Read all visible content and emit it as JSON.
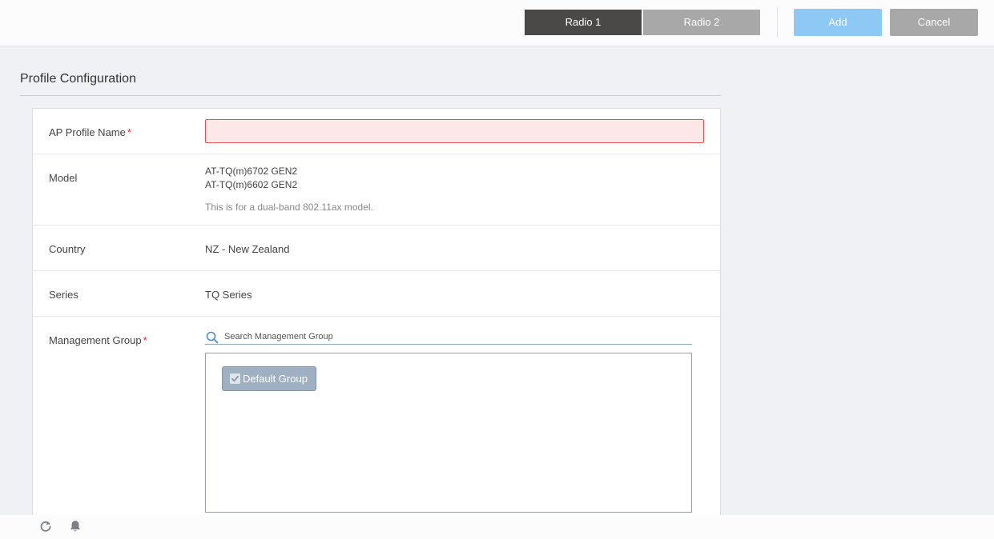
{
  "header": {
    "tabs": [
      {
        "label": "Radio 1",
        "active": true
      },
      {
        "label": "Radio 2",
        "active": false
      }
    ],
    "add_label": "Add",
    "cancel_label": "Cancel"
  },
  "section": {
    "title": "Profile Configuration"
  },
  "form": {
    "profile_name": {
      "label": "AP Profile Name",
      "required_mark": "*",
      "value": ""
    },
    "model": {
      "label": "Model",
      "values": [
        "AT-TQ(m)6702 GEN2",
        "AT-TQ(m)6602 GEN2"
      ],
      "note": "This is for a dual-band 802.11ax model."
    },
    "country": {
      "label": "Country",
      "value": "NZ - New Zealand"
    },
    "series": {
      "label": "Series",
      "value": "TQ Series"
    },
    "management_group": {
      "label": "Management Group",
      "required_mark": "*",
      "search_placeholder": "Search Management Group",
      "groups": [
        {
          "label": "Default Group",
          "checked": true
        }
      ]
    }
  },
  "footer": {
    "icons": [
      "refresh-icon",
      "bell-icon"
    ]
  },
  "colors": {
    "active_tab": "#4a4947",
    "inactive_button": "#a8a8a8",
    "add_button": "#8ec8f5",
    "required": "#d9262c",
    "error_field_bg": "#fde8e8",
    "group_chip": "#9fb0c2"
  }
}
